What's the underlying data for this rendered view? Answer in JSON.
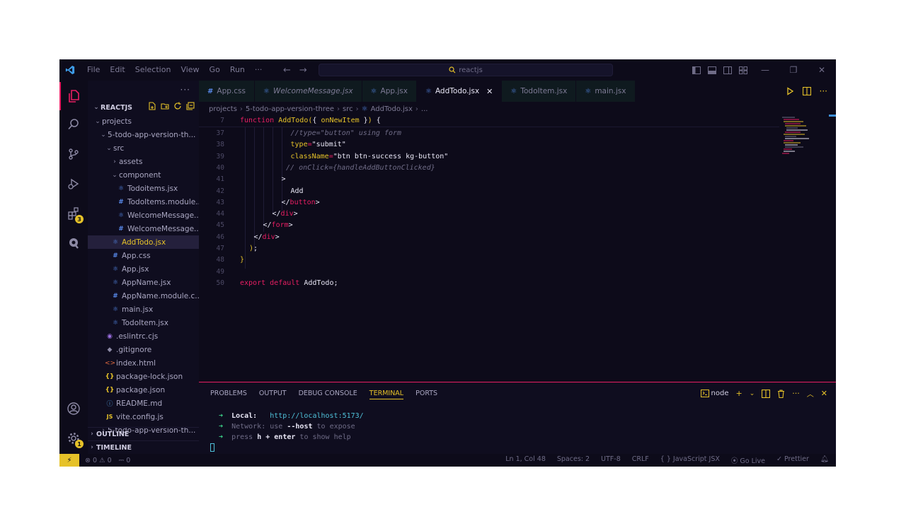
{
  "menu": [
    "File",
    "Edit",
    "Selection",
    "View",
    "Go",
    "Run",
    "···"
  ],
  "search_text": "reactjs",
  "sidebar": {
    "root": "REACTJS",
    "rows": [
      {
        "label": "projects",
        "depth": 0,
        "type": "folder-open",
        "icon": ""
      },
      {
        "label": "5-todo-app-version-th...",
        "depth": 1,
        "type": "folder-open",
        "icon": ""
      },
      {
        "label": "src",
        "depth": 2,
        "type": "folder-open",
        "icon": ""
      },
      {
        "label": "assets",
        "depth": 3,
        "type": "folder-closed",
        "icon": ""
      },
      {
        "label": "component",
        "depth": 3,
        "type": "folder-open",
        "icon": ""
      },
      {
        "label": "Todoitems.jsx",
        "depth": 4,
        "type": "file",
        "icon": "react"
      },
      {
        "label": "TodoItems.module...",
        "depth": 4,
        "type": "file",
        "icon": "hash"
      },
      {
        "label": "WelcomeMessage...",
        "depth": 4,
        "type": "file",
        "icon": "react"
      },
      {
        "label": "WelcomeMessage...",
        "depth": 4,
        "type": "file",
        "icon": "hash"
      },
      {
        "label": "AddTodo.jsx",
        "depth": 3,
        "type": "file",
        "icon": "react",
        "selected": true
      },
      {
        "label": "App.css",
        "depth": 3,
        "type": "file",
        "icon": "hash"
      },
      {
        "label": "App.jsx",
        "depth": 3,
        "type": "file",
        "icon": "react"
      },
      {
        "label": "AppName.jsx",
        "depth": 3,
        "type": "file",
        "icon": "react"
      },
      {
        "label": "AppName.module.c...",
        "depth": 3,
        "type": "file",
        "icon": "hash"
      },
      {
        "label": "main.jsx",
        "depth": 3,
        "type": "file",
        "icon": "react"
      },
      {
        "label": "TodoItem.jsx",
        "depth": 3,
        "type": "file",
        "icon": "react"
      },
      {
        "label": ".eslintrc.cjs",
        "depth": 2,
        "type": "file",
        "icon": "eslint"
      },
      {
        "label": ".gitignore",
        "depth": 2,
        "type": "file",
        "icon": "git"
      },
      {
        "label": "index.html",
        "depth": 2,
        "type": "file",
        "icon": "html"
      },
      {
        "label": "package-lock.json",
        "depth": 2,
        "type": "file",
        "icon": "brace"
      },
      {
        "label": "package.json",
        "depth": 2,
        "type": "file",
        "icon": "brace"
      },
      {
        "label": "README.md",
        "depth": 2,
        "type": "file",
        "icon": "info"
      },
      {
        "label": "vite.config.js",
        "depth": 2,
        "type": "file",
        "icon": "js"
      },
      {
        "label": "5-todo-app-version-th...",
        "depth": 1,
        "type": "folder-closed",
        "icon": ""
      }
    ],
    "sections": [
      "OUTLINE",
      "TIMELINE"
    ]
  },
  "tabs": [
    {
      "label": "App.css",
      "icon": "hash",
      "italic": false,
      "active": false
    },
    {
      "label": "WelcomeMessage.jsx",
      "icon": "react",
      "italic": true,
      "active": false
    },
    {
      "label": "App.jsx",
      "icon": "react",
      "italic": false,
      "active": false
    },
    {
      "label": "AddTodo.jsx",
      "icon": "react",
      "italic": false,
      "active": true
    },
    {
      "label": "TodoItem.jsx",
      "icon": "react",
      "italic": false,
      "active": false
    },
    {
      "label": "main.jsx",
      "icon": "react",
      "italic": false,
      "active": false
    }
  ],
  "breadcrumb": [
    "projects",
    "5-todo-app-version-three",
    "src",
    "AddTodo.jsx",
    "..."
  ],
  "editor": {
    "sticky": {
      "line": "7",
      "html": "<span class=\"k\">function</span> <span class=\"fn\">AddTodo</span><span class=\"pn\">(</span>{ <span class=\"fn\">onNewItem</span> }<span class=\"pn\">)</span> {"
    },
    "lines": [
      {
        "n": "37",
        "indent": 11,
        "html": "<span class=\"cm\">//type=\"button\" using form</span>"
      },
      {
        "n": "38",
        "indent": 11,
        "html": "<span class=\"at\">type</span><span class=\"op\">=</span><span class=\"str\">\"submit\"</span>"
      },
      {
        "n": "39",
        "indent": 11,
        "html": "<span class=\"at\">className</span><span class=\"op\">=</span><span class=\"str\">\"btn btn-success kg-button\"</span>"
      },
      {
        "n": "40",
        "indent": 10,
        "html": "<span class=\"cm\">// onClick={handleAddButtonClicked}</span>"
      },
      {
        "n": "41",
        "indent": 9,
        "html": "<span class=\"str\">&gt;</span>"
      },
      {
        "n": "42",
        "indent": 11,
        "html": "<span class=\"str\">Add</span>"
      },
      {
        "n": "43",
        "indent": 9,
        "html": "<span class=\"str\">&lt;/</span><span class=\"tg\">button</span><span class=\"str\">&gt;</span>"
      },
      {
        "n": "44",
        "indent": 7,
        "html": "<span class=\"str\">&lt;/</span><span class=\"tg\">div</span><span class=\"str\">&gt;</span>"
      },
      {
        "n": "45",
        "indent": 5,
        "html": "<span class=\"str\">&lt;/</span><span class=\"tg\">form</span><span class=\"str\">&gt;</span>"
      },
      {
        "n": "46",
        "indent": 3,
        "html": "<span class=\"str\">&lt;/</span><span class=\"tg\">div</span><span class=\"str\">&gt;</span>"
      },
      {
        "n": "47",
        "indent": 2,
        "html": "<span class=\"pn\">)</span>;"
      },
      {
        "n": "48",
        "indent": 0,
        "html": "<span class=\"pn\">}</span>"
      },
      {
        "n": "49",
        "indent": 0,
        "html": ""
      },
      {
        "n": "50",
        "indent": 0,
        "html": "<span class=\"k\">export</span> <span class=\"k\">default</span> AddTodo;"
      }
    ]
  },
  "panel": {
    "tabs": [
      "PROBLEMS",
      "OUTPUT",
      "DEBUG CONSOLE",
      "TERMINAL",
      "PORTS"
    ],
    "active_tab": "TERMINAL",
    "shell": "node",
    "terminal": {
      "local_label": "Local:",
      "local_url": "http://localhost:5173/",
      "network_label": "Network:",
      "network_text_pre": "use",
      "network_flag": "--host",
      "network_text_post": "to expose",
      "help_pre": "press",
      "help_key": "h + enter",
      "help_post": "to show help"
    }
  },
  "statusbar": {
    "errors": "0",
    "warnings": "0",
    "ports": "0",
    "position": "Ln 1, Col 48",
    "spaces": "Spaces: 2",
    "encoding": "UTF-8",
    "eol": "CRLF",
    "language": "JavaScript JSX",
    "golive": "Go Live",
    "prettier": "Prettier"
  },
  "colors": {
    "accent_pink": "#e91e63",
    "accent_yellow": "#e6c229",
    "background": "#0d0b1a"
  },
  "badges": {
    "extensions": "3",
    "settings": "1"
  }
}
